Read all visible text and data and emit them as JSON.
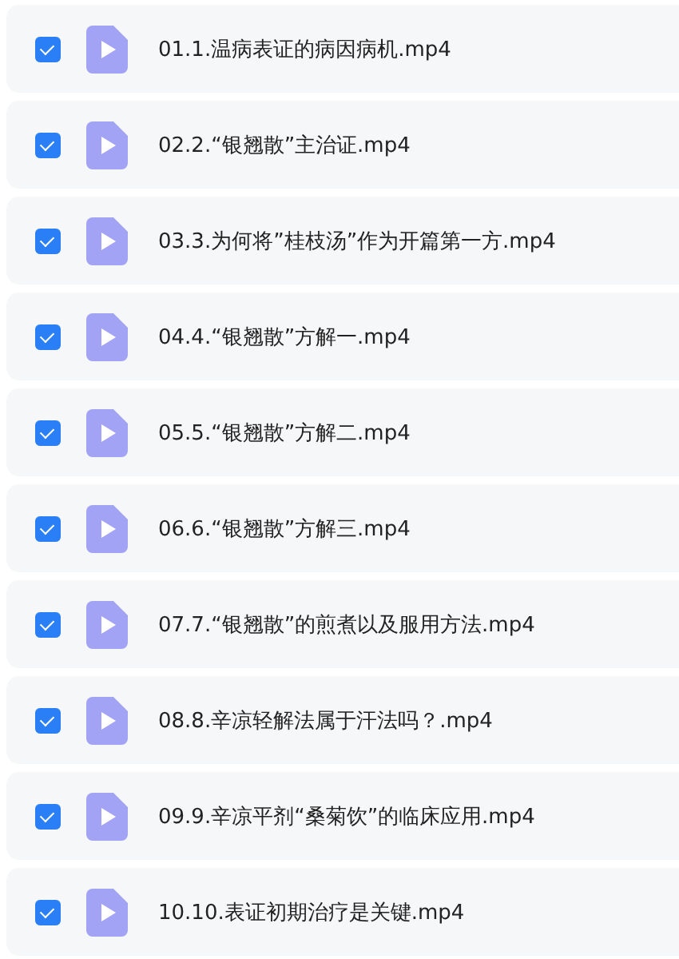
{
  "files": [
    {
      "name": "01.1.温病表证的病因病机.mp4",
      "checked": true
    },
    {
      "name": "02.2.“银翘散”主治证.mp4",
      "checked": true
    },
    {
      "name": "03.3.为何将”桂枝汤”作为开篇第一方.mp4",
      "checked": true
    },
    {
      "name": "04.4.“银翘散”方解一.mp4",
      "checked": true
    },
    {
      "name": "05.5.“银翘散”方解二.mp4",
      "checked": true
    },
    {
      "name": "06.6.“银翘散”方解三.mp4",
      "checked": true
    },
    {
      "name": "07.7.“银翘散”的煎煮以及服用方法.mp4",
      "checked": true
    },
    {
      "name": "08.8.辛凉轻解法属于汗法吗？.mp4",
      "checked": true
    },
    {
      "name": "09.9.辛凉平剂“桑菊饮”的临床应用.mp4",
      "checked": true
    },
    {
      "name": "10.10.表证初期治疗是关键.mp4",
      "checked": true
    }
  ]
}
